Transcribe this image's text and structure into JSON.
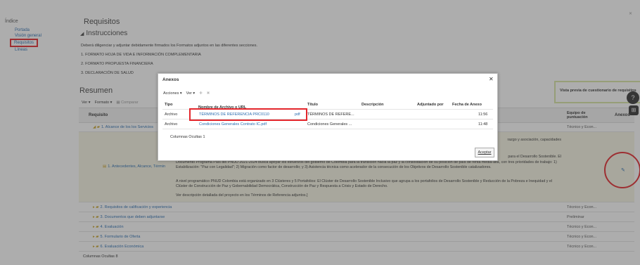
{
  "sidebar": {
    "title": "Índice",
    "items": [
      {
        "label": "Portada"
      },
      {
        "label": "Visión general"
      },
      {
        "label": "Requisitos"
      },
      {
        "label": "Líneas"
      }
    ]
  },
  "main": {
    "title": "Requisitos",
    "instructions_title": "Instrucciones",
    "instructions": [
      "Deberá diligenciar y adjuntar debidamente firmados los Formatos adjuntos en las diferentes secciones.",
      "1. FORMATO HOJA DE VIDA E INFORMACIÓN COMPLEMENTARIA",
      "2. FORMATO PROPUESTA FINANCIERA",
      "3. DECLARACIÓN DE SALUD"
    ],
    "summary_title": "Resumen",
    "toolbar": {
      "view": "Ver",
      "format": "Formato",
      "compare": "Comparar"
    },
    "vista_button": "Vista previa de cuestionario de requisitos",
    "columns": {
      "requisito": "Requisito",
      "equipo": "Equipo de puntuación",
      "anexos": "Anexos"
    },
    "rows": [
      {
        "label": "1. Alcance de los los Servicios",
        "value": "Técnico y Econ..."
      },
      {
        "label": "1. Antecedentes, Alcance, Términ",
        "value": ""
      },
      {
        "label": "2. Requisitos de calificación y experiencia",
        "value": "Técnico y Econ..."
      },
      {
        "label": "3. Documentos que deben adjuntarse",
        "value": "Preliminar"
      },
      {
        "label": "4. Evaluación",
        "value": "Técnico y Econ..."
      },
      {
        "label": "5. Formulario de Oferta",
        "value": "Técnico y Econ..."
      },
      {
        "label": "6. Evaluación Económica",
        "value": "Técnico y Econ..."
      }
    ],
    "desc_lines": [
      "razgo y asociación, capacidades",
      "Documento Programa País del PNUD 2021-2024 busca apoyar los esfuerzos del gobierno de Colombia para la transición hacia la paz y la consolidación de su posición de país de renta media-alta, con tres prioridades de trabajo: 1) Estabilización: \"Paz con Legalidad\"; 2) Migración como factor de desarrollo; y 3) Asistencia técnica como acelerador de la consecución de los Objetivos de Desarrollo Sostenible catalizadores.",
      "A nivel programático PNUD Colombia está organizado en 3 Clústeres y 5 Portafolios: El Clúster de Desarrollo Sostenible Inclusivo que agrupa a los portafolios de Desarrollo Sostenible y Reducción de la Pobreza e Inequidad y el Clúster de Construcción de Paz y Gobernabilidad Democrática, Construcción de Paz y Respuesta a Crisis y Estado de Derecho.",
      "Ver descripción detallada del proyecto en los Términos de Referencia adjuntos.]",
      "para el Desarrollo Sostenible. El"
    ],
    "hidden_columns": "Columnas Ocultas 8"
  },
  "dialog": {
    "title": "Anexos",
    "toolbar": {
      "actions": "Acciones",
      "view": "Ver"
    },
    "columns": [
      "Tipo",
      "Nombre de Archivo o URL",
      "Título",
      "Descripción",
      "Adjuntado por",
      "Fecha de Anexo"
    ],
    "rows": [
      {
        "tipo": "Archivo",
        "nombre": "TÉRMINOS DE REFERENCIA PRC0110",
        "ext": "pdf",
        "titulo": "TÉRMINOS DE REFERE...",
        "descripcion": "",
        "adjuntado": "",
        "fecha": "11:56"
      },
      {
        "tipo": "Archivo",
        "nombre": "Condiciones Generales Contrato IC.pdf",
        "ext": "",
        "titulo": "Condiciones Generales ...",
        "descripcion": "",
        "adjuntado": "",
        "fecha": "11:48"
      }
    ],
    "hidden_columns": "Columnas Ocultas 1",
    "accept": "Aceptar"
  }
}
